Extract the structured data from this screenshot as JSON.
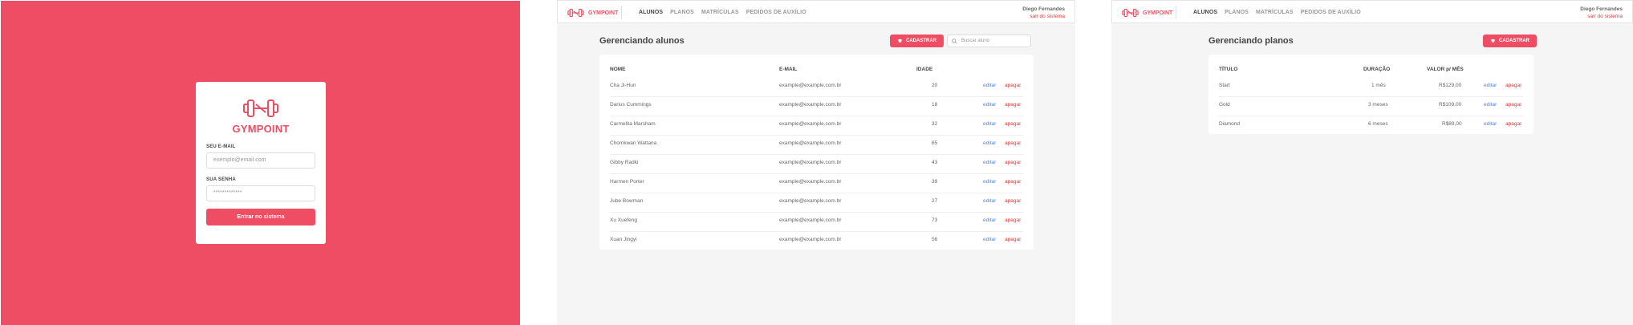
{
  "login": {
    "brand": "GYMPOINT",
    "email_label": "SEU E-MAIL",
    "email_placeholder": "exemplo@email.com",
    "password_label": "SUA SENHA",
    "password_value": "*************",
    "submit_label": "Entrar no sistema"
  },
  "header": {
    "brand": "GYMPOINT",
    "nav": [
      "ALUNOS",
      "PLANOS",
      "MATRÍCULAS",
      "PEDIDOS DE AUXÍLIO"
    ],
    "user_name": "Diego Fernandes",
    "logout_label": "sair do sistema"
  },
  "students": {
    "title": "Gerenciando alunos",
    "add_label": "CADASTRAR",
    "search_placeholder": "Buscar aluno",
    "columns": [
      "NOME",
      "E-MAIL",
      "IDADE"
    ],
    "rows": [
      {
        "name": "Cha Ji-Hun",
        "email": "example@example.com.br",
        "age": "20"
      },
      {
        "name": "Darius Cummings",
        "email": "example@example.com.br",
        "age": "18"
      },
      {
        "name": "Carmelita Marsham",
        "email": "example@example.com.br",
        "age": "32"
      },
      {
        "name": "Chomkwan Wattana",
        "email": "example@example.com.br",
        "age": "65"
      },
      {
        "name": "Gibby Radki",
        "email": "example@example.com.br",
        "age": "43"
      },
      {
        "name": "Harmen Porter",
        "email": "example@example.com.br",
        "age": "39"
      },
      {
        "name": "Jube Bowman",
        "email": "example@example.com.br",
        "age": "27"
      },
      {
        "name": "Xu Xuefeng",
        "email": "example@example.com.br",
        "age": "73"
      },
      {
        "name": "Xuan Jingyi",
        "email": "example@example.com.br",
        "age": "56"
      }
    ]
  },
  "plans": {
    "title": "Gerenciando planos",
    "add_label": "CADASTRAR",
    "columns": [
      "TÍTULO",
      "DURAÇÃO",
      "VALOR p/ MÊS"
    ],
    "rows": [
      {
        "title": "Start",
        "duration": "1 mês",
        "price": "R$129,00"
      },
      {
        "title": "Gold",
        "duration": "3 meses",
        "price": "R$109,00"
      },
      {
        "title": "Diamond",
        "duration": "6 meses",
        "price": "R$89,00"
      }
    ]
  },
  "actions": {
    "edit": "editar",
    "delete": "apagar"
  },
  "colors": {
    "brand": "#ee4d64",
    "edit": "#4d85ee",
    "delete": "#de3b3b",
    "background": "#f5f5f5"
  },
  "icons": {
    "logo": "dumbbell-icon",
    "add": "graduation-cap-icon",
    "search": "search-icon"
  }
}
